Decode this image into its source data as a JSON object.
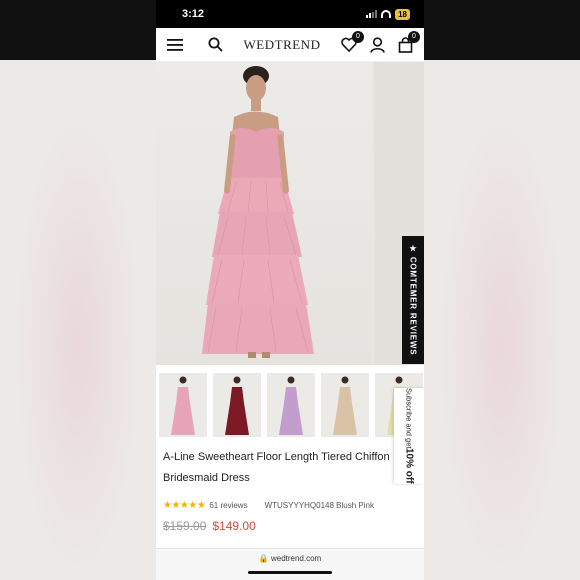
{
  "status": {
    "time": "3:12",
    "battery": "18"
  },
  "nav": {
    "logo": "WEDTREND",
    "wishlist_count": "0",
    "cart_count": "0"
  },
  "hero": {
    "reviews_tab": "★ COMTEMER REVIEWS"
  },
  "thumbnails": [
    {
      "color": "#e7a4b7"
    },
    {
      "color": "#7b1a25"
    },
    {
      "color": "#c39ecd"
    },
    {
      "color": "#d8c3a6"
    },
    {
      "color": "#dfe0a7"
    }
  ],
  "subscribe": {
    "text": "Subscribe and get ",
    "bold": "10% off"
  },
  "product": {
    "title": "A-Line Sweetheart Floor Length Tiered Chiffon Bridesmaid Dress",
    "stars": "★★★★★",
    "reviews": "61 reviews",
    "sku": "WTUSYYYHQ0148 Blush Pink",
    "old_price": "$159.00",
    "price": "$149.00"
  },
  "browser": {
    "url": "wedtrend.com"
  },
  "colors": {
    "dress": "#e8a6b5",
    "accent": "#d2473c",
    "stars": "#f2b600"
  }
}
